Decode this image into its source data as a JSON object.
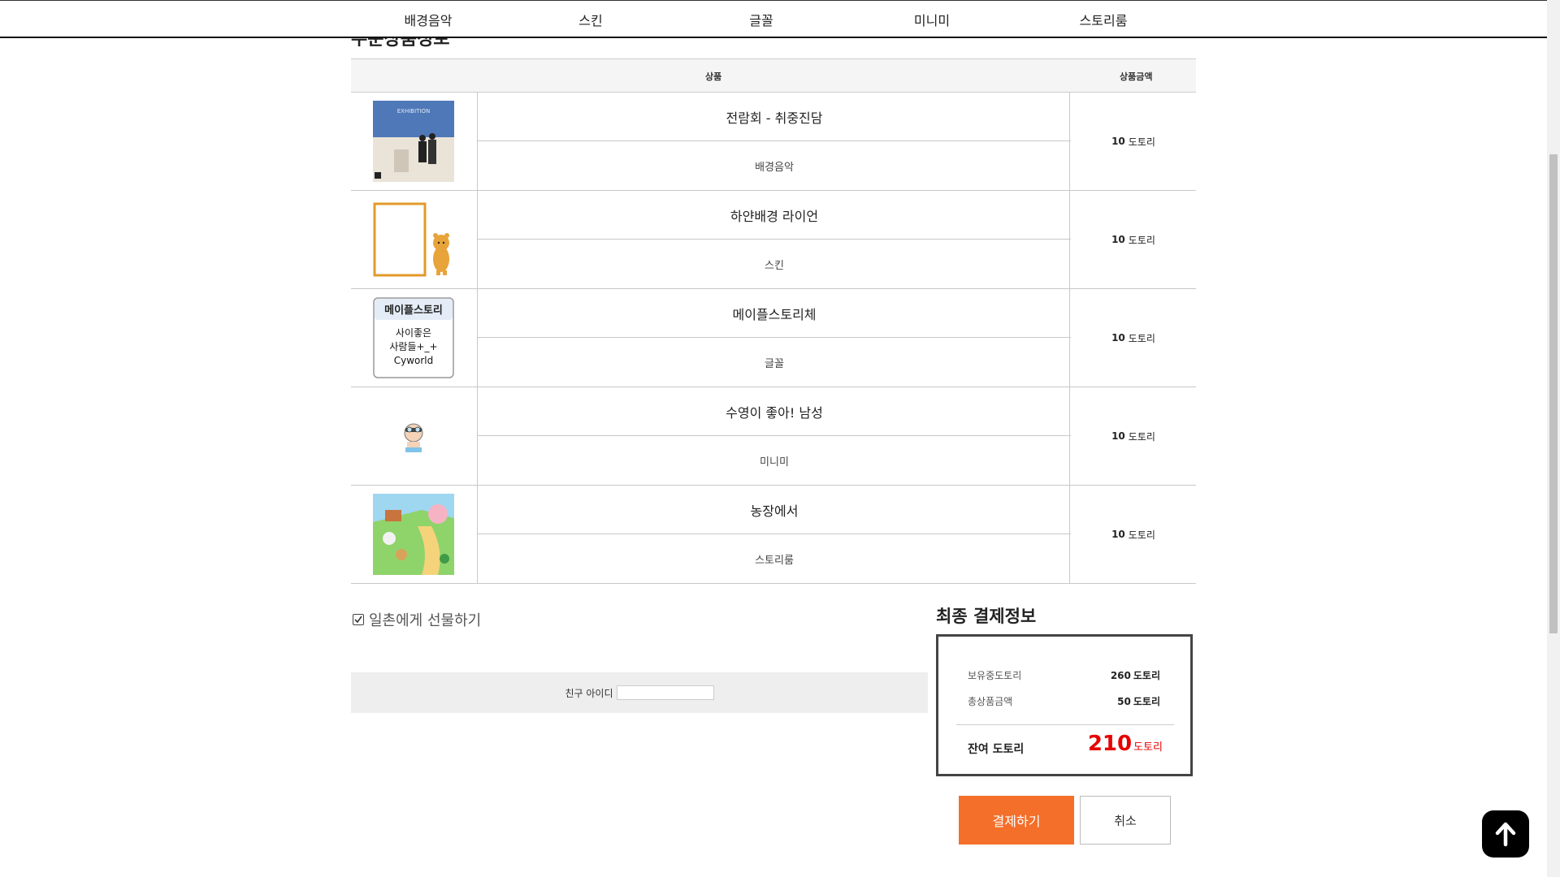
{
  "nav": {
    "items": [
      {
        "label": "배경음악"
      },
      {
        "label": "스킨"
      },
      {
        "label": "글꼴"
      },
      {
        "label": "미니미"
      },
      {
        "label": "스토리룸"
      }
    ]
  },
  "page": {
    "heading": "주문상품정보"
  },
  "table": {
    "header_product": "상품",
    "header_price": "상품금액",
    "rows": [
      {
        "name": "전람회 - 취중진담",
        "category": "배경음악",
        "price": "10",
        "unit": "도토리",
        "thumb_icon": "album-cover-icon",
        "thumb_text": "EXHIBITION"
      },
      {
        "name": "하얀배경 라이언",
        "category": "스킨",
        "price": "10",
        "unit": "도토리",
        "thumb_icon": "skin-preview-icon"
      },
      {
        "name": "메이플스토리체",
        "category": "글꼴",
        "price": "10",
        "unit": "도토리",
        "thumb_icon": "font-preview-icon",
        "thumb_title": "메이플스토리",
        "thumb_line1": "사이좋은",
        "thumb_line2": "사람들+_+",
        "thumb_line3": "Cyworld"
      },
      {
        "name": "수영이 좋아! 남성",
        "category": "미니미",
        "price": "10",
        "unit": "도토리",
        "thumb_icon": "minimi-character-icon"
      },
      {
        "name": "농장에서",
        "category": "스토리룸",
        "price": "10",
        "unit": "도토리",
        "thumb_icon": "storyroom-farm-icon"
      }
    ]
  },
  "gift": {
    "label": "일촌에게 선물하기",
    "checked": true,
    "friend_id_label": "친구 아이디",
    "friend_id_value": ""
  },
  "final": {
    "title": "최종 결제정보",
    "owned_label": "보유중도토리",
    "owned_value": "260",
    "total_label": "총상품금액",
    "total_value": "50",
    "unit": "도토리",
    "remain_label": "잔여 도토리",
    "remain_value": "210",
    "accent_color": "#e60000"
  },
  "buttons": {
    "pay_label": "결제하기",
    "cancel_label": "취소",
    "pay_color": "#f36f2a"
  }
}
